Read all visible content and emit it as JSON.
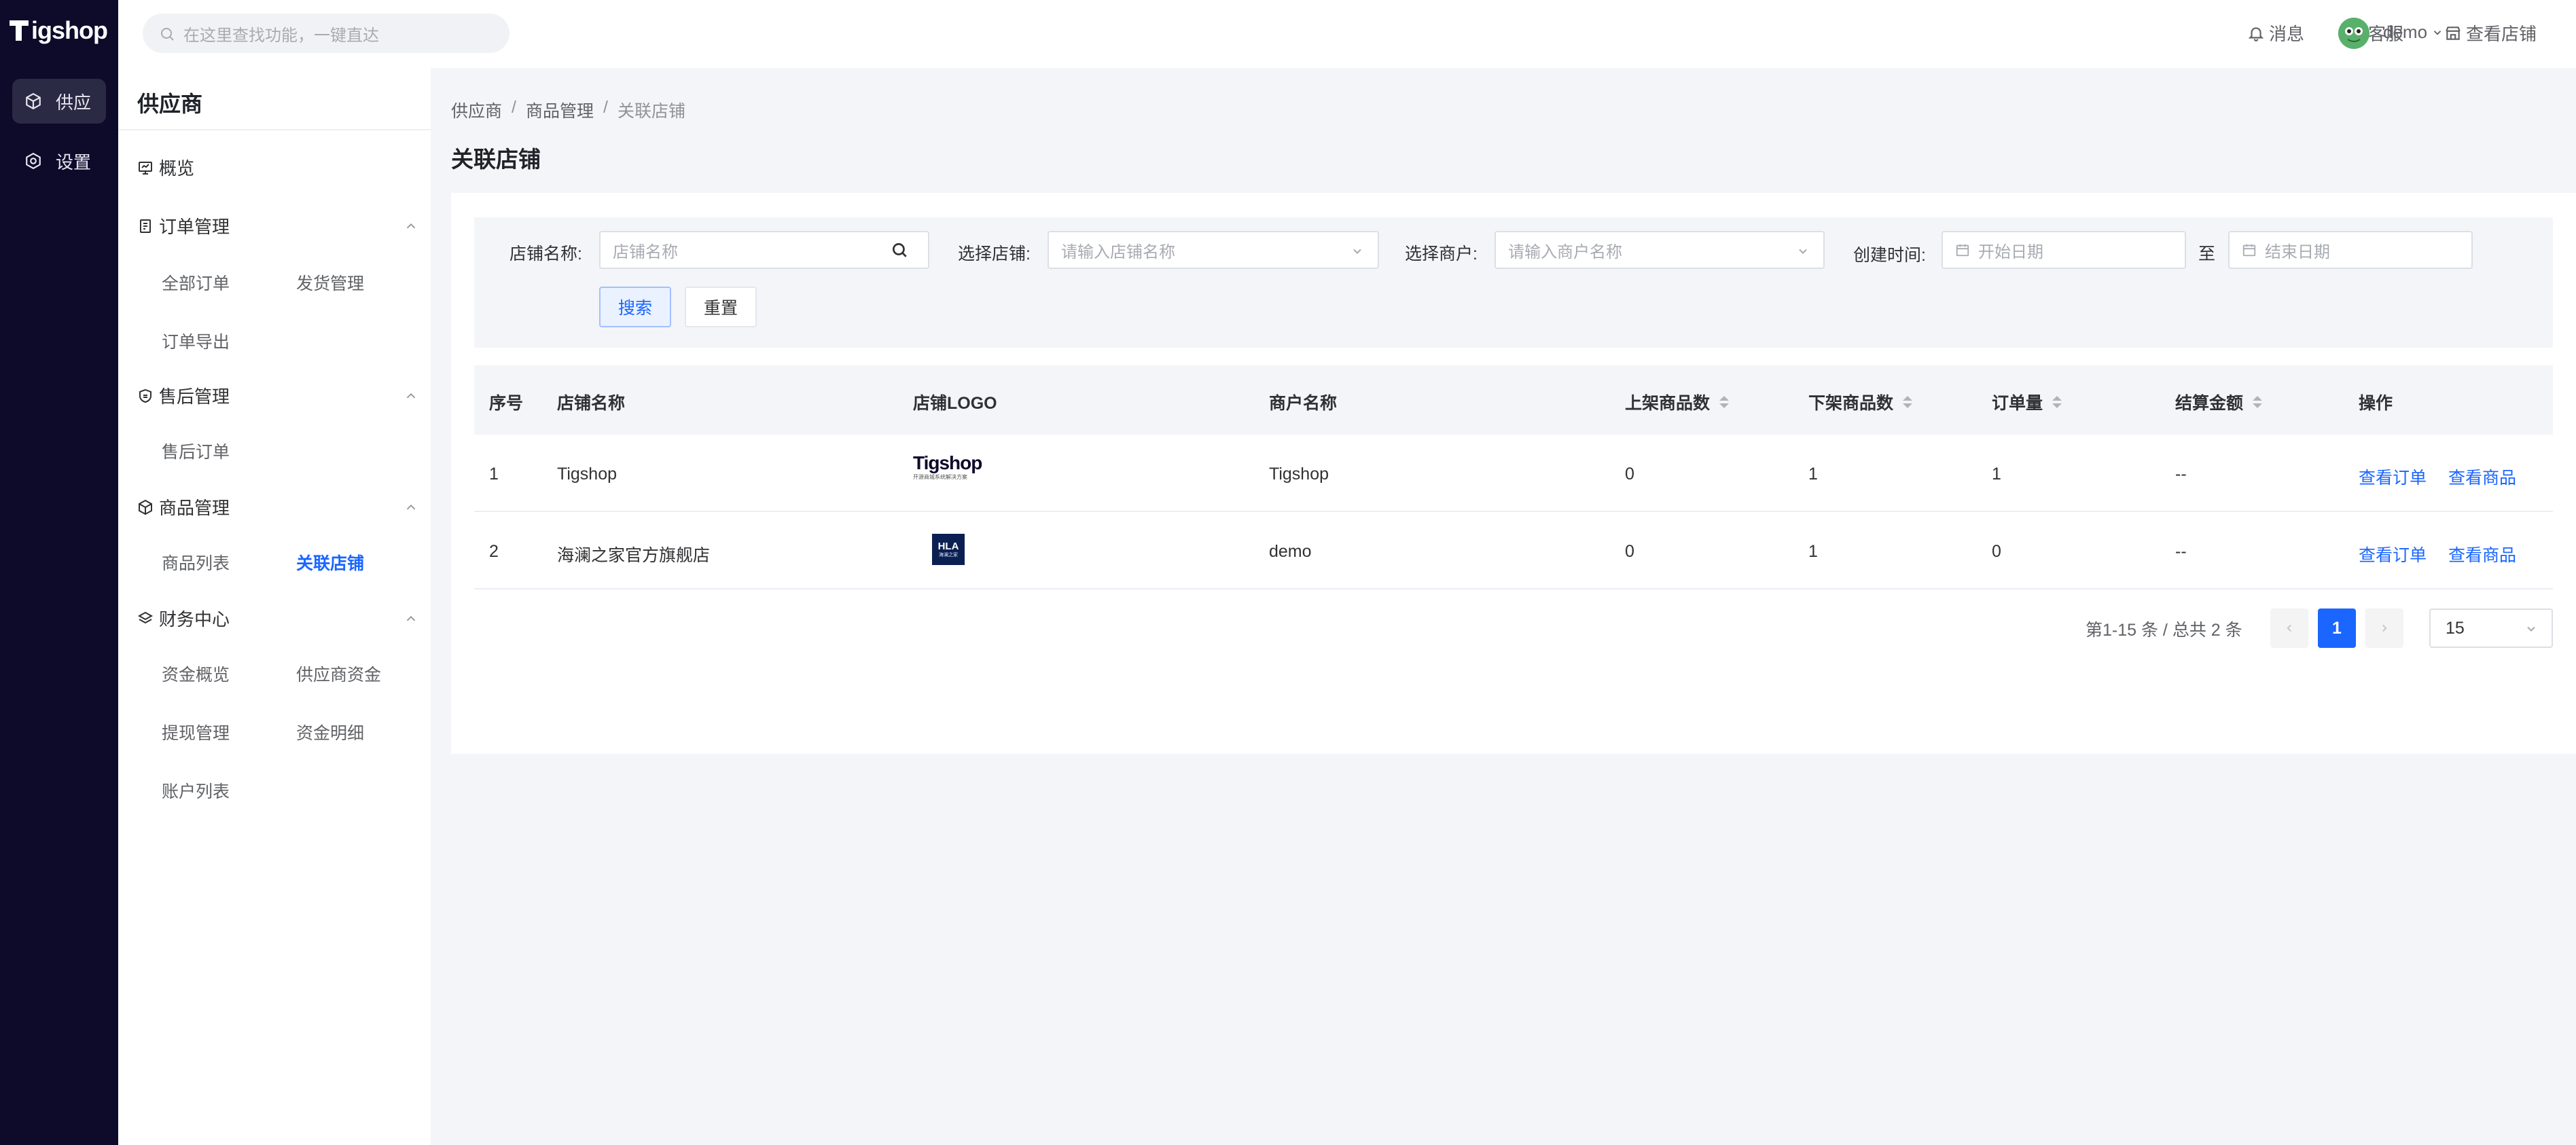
{
  "app": {
    "logo_text": "igshop",
    "rail": [
      {
        "label": "供应",
        "active": true
      },
      {
        "label": "设置",
        "active": false
      }
    ]
  },
  "topbar": {
    "search_placeholder": "在这里查找功能，一键直达",
    "messages": "消息",
    "service": "客服",
    "view_store": "查看店铺",
    "user": "demo"
  },
  "sidebar": {
    "title": "供应商",
    "overview": "概览",
    "order_group": "订单管理",
    "all_orders": "全部订单",
    "shipping": "发货管理",
    "order_export": "订单导出",
    "after_sale_group": "售后管理",
    "after_sale_orders": "售后订单",
    "product_group": "商品管理",
    "product_list": "商品列表",
    "linked_stores": "关联店铺",
    "finance_group": "财务中心",
    "fund_overview": "资金概览",
    "supplier_funds": "供应商资金",
    "withdraw": "提现管理",
    "fund_detail": "资金明细",
    "accounts": "账户列表"
  },
  "breadcrumb": [
    "供应商",
    "商品管理",
    "关联店铺"
  ],
  "page_title": "关联店铺",
  "filters": {
    "store_name_label": "店铺名称:",
    "store_name_placeholder": "店铺名称",
    "select_store_label": "选择店铺:",
    "select_store_placeholder": "请输入店铺名称",
    "select_merchant_label": "选择商户:",
    "select_merchant_placeholder": "请输入商户名称",
    "created_label": "创建时间:",
    "start_placeholder": "开始日期",
    "to": "至",
    "end_placeholder": "结束日期",
    "search_btn": "搜索",
    "reset_btn": "重置"
  },
  "table": {
    "headers": {
      "index": "序号",
      "store_name": "店铺名称",
      "store_logo": "店铺LOGO",
      "merchant": "商户名称",
      "on_shelf": "上架商品数",
      "off_shelf": "下架商品数",
      "orders": "订单量",
      "settlement": "结算金额",
      "actions": "操作"
    },
    "rows": [
      {
        "index": "1",
        "store_name": "Tigshop",
        "logo_text": "Tigshop",
        "logo_sub": "开源商城系统解决方案",
        "merchant": "Tigshop",
        "on_shelf": "0",
        "off_shelf": "1",
        "orders": "1",
        "settlement": "--",
        "view_orders": "查看订单",
        "view_products": "查看商品"
      },
      {
        "index": "2",
        "store_name": "海澜之家官方旗舰店",
        "logo_text": "HLA",
        "logo_sub": "海澜之家",
        "merchant": "demo",
        "on_shelf": "0",
        "off_shelf": "1",
        "orders": "0",
        "settlement": "--",
        "view_orders": "查看订单",
        "view_products": "查看商品"
      }
    ]
  },
  "pagination": {
    "total_text": "第1-15 条 / 总共 2 条",
    "current_page": "1",
    "page_size": "15"
  },
  "colors": {
    "rail_bg": "#0e0a2a",
    "primary": "#1a66ff"
  }
}
